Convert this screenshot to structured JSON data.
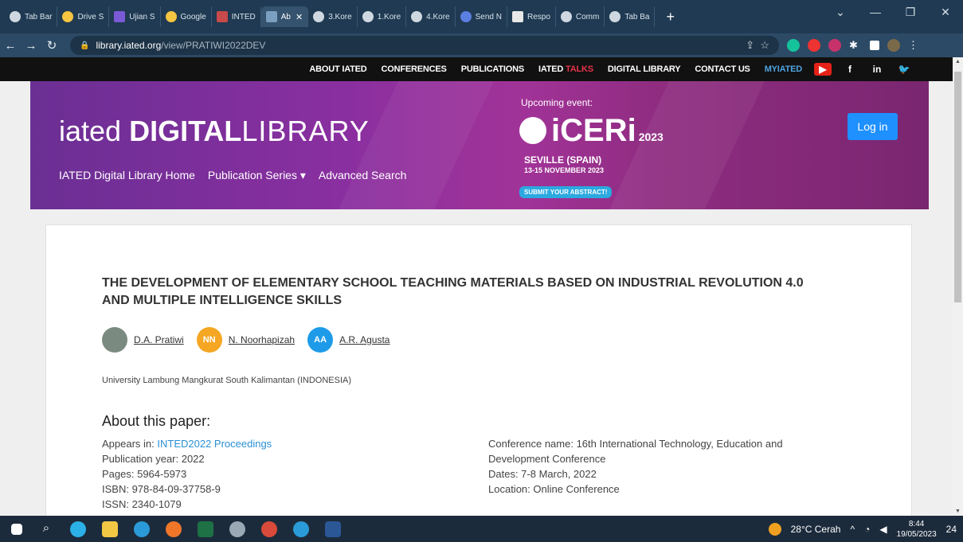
{
  "browser": {
    "tabs": [
      {
        "label": "Tab Bar",
        "active": false
      },
      {
        "label": "Drive S",
        "active": false
      },
      {
        "label": "Ujian S",
        "active": false
      },
      {
        "label": "Google",
        "active": false
      },
      {
        "label": "INTED",
        "active": false
      },
      {
        "label": "Ab",
        "active": true
      },
      {
        "label": "3.Kore",
        "active": false
      },
      {
        "label": "1.Kore",
        "active": false
      },
      {
        "label": "4.Kore",
        "active": false
      },
      {
        "label": "Send N",
        "active": false
      },
      {
        "label": "Respo",
        "active": false
      },
      {
        "label": "Comm",
        "active": false
      },
      {
        "label": "Tab Ba",
        "active": false
      }
    ],
    "url_host": "library.iated.org",
    "url_path": "/view/PRATIWI2022DEV"
  },
  "topnav": {
    "items": [
      "ABOUT IATED",
      "CONFERENCES",
      "PUBLICATIONS"
    ],
    "talks_prefix": "IATED",
    "talks_suffix": "TALKS",
    "items2": [
      "DIGITAL LIBRARY",
      "CONTACT US"
    ],
    "myiated": "MYIATED"
  },
  "banner": {
    "logo_prefix": "iated",
    "logo_bold": "DIGITAL",
    "logo_light": "LIBRARY",
    "nav": [
      "IATED Digital Library Home",
      "Publication Series ▾",
      "Advanced Search"
    ],
    "event_label": "Upcoming event:",
    "event_name": "iCERi",
    "event_year": "2023",
    "event_city": "SEVILLE (SPAIN)",
    "event_dates": "13-15 NOVEMBER 2023",
    "submit": "SUBMIT YOUR ABSTRACT!",
    "login": "Log in"
  },
  "paper": {
    "title": "THE DEVELOPMENT OF ELEMENTARY SCHOOL TEACHING MATERIALS BASED ON INDUSTRIAL REVOLUTION 4.0 AND MULTIPLE INTELLIGENCE SKILLS",
    "authors": [
      {
        "initials": "",
        "name": "D.A. Pratiwi",
        "color": "#7a8a80"
      },
      {
        "initials": "NN",
        "name": "N. Noorhapizah",
        "color": "#f5a623"
      },
      {
        "initials": "AA",
        "name": "A.R. Agusta",
        "color": "#1e9be8"
      }
    ],
    "affiliation": "University Lambung Mangkurat South Kalimantan (INDONESIA)",
    "about_heading": "About this paper:",
    "appears_label": "Appears in: ",
    "appears_link": "INTED2022 Proceedings",
    "pub_year": "Publication year: 2022",
    "pages": "Pages: 5964-5973",
    "isbn": "ISBN: 978-84-09-37758-9",
    "issn": "ISSN: 2340-1079",
    "conf_name_1": "Conference name: 16th International Technology, Education and",
    "conf_name_2": "Development Conference",
    "dates": "Dates: 7-8 March, 2022",
    "location": "Location: Online Conference"
  },
  "taskbar": {
    "weather": "28°C  Cerah",
    "time": "8:44",
    "date": "19/05/2023",
    "notif": "24"
  }
}
